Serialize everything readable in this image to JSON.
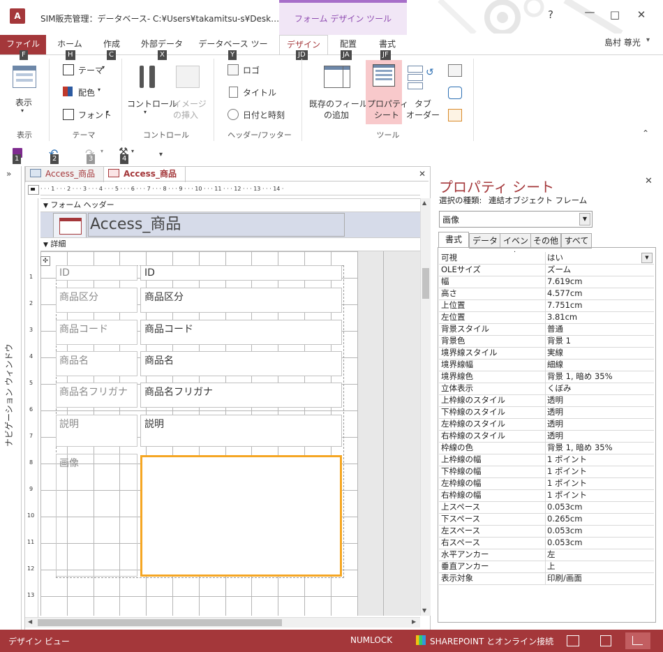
{
  "window": {
    "title": "SIM販売管理：データベース- C:¥Users¥takamitsu-s¥Desk…",
    "context_label": "フォーム デザイン ツール",
    "help": "?",
    "user": "島村 尊光"
  },
  "tabs": [
    {
      "label": "ファイル",
      "key": "F"
    },
    {
      "label": "ホーム",
      "key": "H"
    },
    {
      "label": "作成",
      "key": "C"
    },
    {
      "label": "外部データ",
      "key": "X"
    },
    {
      "label": "データベース ツール",
      "key": "Y"
    },
    {
      "label": "デザイン",
      "key": "JD"
    },
    {
      "label": "配置",
      "key": "JA"
    },
    {
      "label": "書式",
      "key": "JF"
    }
  ],
  "ribbon": {
    "view": {
      "label": "表示",
      "group": "表示"
    },
    "theme": {
      "themes": "テーマ",
      "colors": "配色",
      "fonts": "フォント",
      "group": "テーマ"
    },
    "controls": {
      "controls": "コントロール",
      "image": "イメージ",
      "image2": "の挿入",
      "group": "コントロール"
    },
    "header": {
      "logo": "ロゴ",
      "title": "タイトル",
      "datetime": "日付と時刻",
      "group": "ヘッダー/フッター"
    },
    "tools": {
      "existing1": "既存のフィールド",
      "existing2": "の追加",
      "prop1": "プロパティ",
      "prop2": "シート",
      "tab1": "タブ",
      "tab2": "オーダー",
      "group": "ツール"
    }
  },
  "qat": {
    "keys": [
      "1",
      "2",
      "3",
      "4"
    ]
  },
  "nav": {
    "label": "ナビゲーション ウィンドウ"
  },
  "doc": {
    "tab1": "Access_商品",
    "tab2": "Access_商品",
    "ruler": "· · · 1 · · · 2 · · · 3 · · · 4 · · · 5 · · · 6 · · · 7 · · · 8 · · · 9 · · · 10 · · · 11 · · · 12 · · · 13 · · · 14 ·",
    "form_header": "フォーム ヘッダー",
    "form_title": "Access_商品",
    "detail": "詳細",
    "vruler": [
      "1",
      "2",
      "3",
      "4",
      "5",
      "6",
      "7",
      "8",
      "9",
      "10",
      "11",
      "12",
      "13"
    ],
    "fields": [
      {
        "label": "ID",
        "value": "ID"
      },
      {
        "label": "商品区分",
        "value": "商品区分"
      },
      {
        "label": "商品コード",
        "value": "商品コード"
      },
      {
        "label": "商品名",
        "value": "商品名"
      },
      {
        "label": "商品名フリガナ",
        "value": "商品名フリガナ"
      },
      {
        "label": "説明",
        "value": "説明"
      },
      {
        "label": "画像",
        "value": ""
      }
    ]
  },
  "props": {
    "title": "プロパティ シート",
    "selection_label": "選択の種類:",
    "selection_type": "連結オブジェクト フレーム",
    "object": "画像",
    "tabs": [
      "書式",
      "データ",
      "イベント",
      "その他",
      "すべて"
    ],
    "rows": [
      [
        "可視",
        "はい"
      ],
      [
        "OLEサイズ",
        "ズーム"
      ],
      [
        "幅",
        "7.619cm"
      ],
      [
        "高さ",
        "4.577cm"
      ],
      [
        "上位置",
        "7.751cm"
      ],
      [
        "左位置",
        "3.81cm"
      ],
      [
        "背景スタイル",
        "普通"
      ],
      [
        "背景色",
        "背景 1"
      ],
      [
        "境界線スタイル",
        "実線"
      ],
      [
        "境界線幅",
        "細線"
      ],
      [
        "境界線色",
        "背景 1, 暗め 35%"
      ],
      [
        "立体表示",
        "くぼみ"
      ],
      [
        "上枠線のスタイル",
        "透明"
      ],
      [
        "下枠線のスタイル",
        "透明"
      ],
      [
        "左枠線のスタイル",
        "透明"
      ],
      [
        "右枠線のスタイル",
        "透明"
      ],
      [
        "枠線の色",
        "背景 1, 暗め 35%"
      ],
      [
        "上枠線の幅",
        "1 ポイント"
      ],
      [
        "下枠線の幅",
        "1 ポイント"
      ],
      [
        "左枠線の幅",
        "1 ポイント"
      ],
      [
        "右枠線の幅",
        "1 ポイント"
      ],
      [
        "上スペース",
        "0.053cm"
      ],
      [
        "下スペース",
        "0.265cm"
      ],
      [
        "左スペース",
        "0.053cm"
      ],
      [
        "右スペース",
        "0.053cm"
      ],
      [
        "水平アンカー",
        "左"
      ],
      [
        "垂直アンカー",
        "上"
      ],
      [
        "表示対象",
        "印刷/画面"
      ]
    ]
  },
  "status": {
    "mode": "デザイン ビュー",
    "numlock": "NUMLOCK",
    "sharepoint": "SHAREPOINT とオンライン接続"
  },
  "colors": {
    "accent": "#a4373a",
    "context": "#8e4bb0",
    "selection": "#f5a623"
  }
}
